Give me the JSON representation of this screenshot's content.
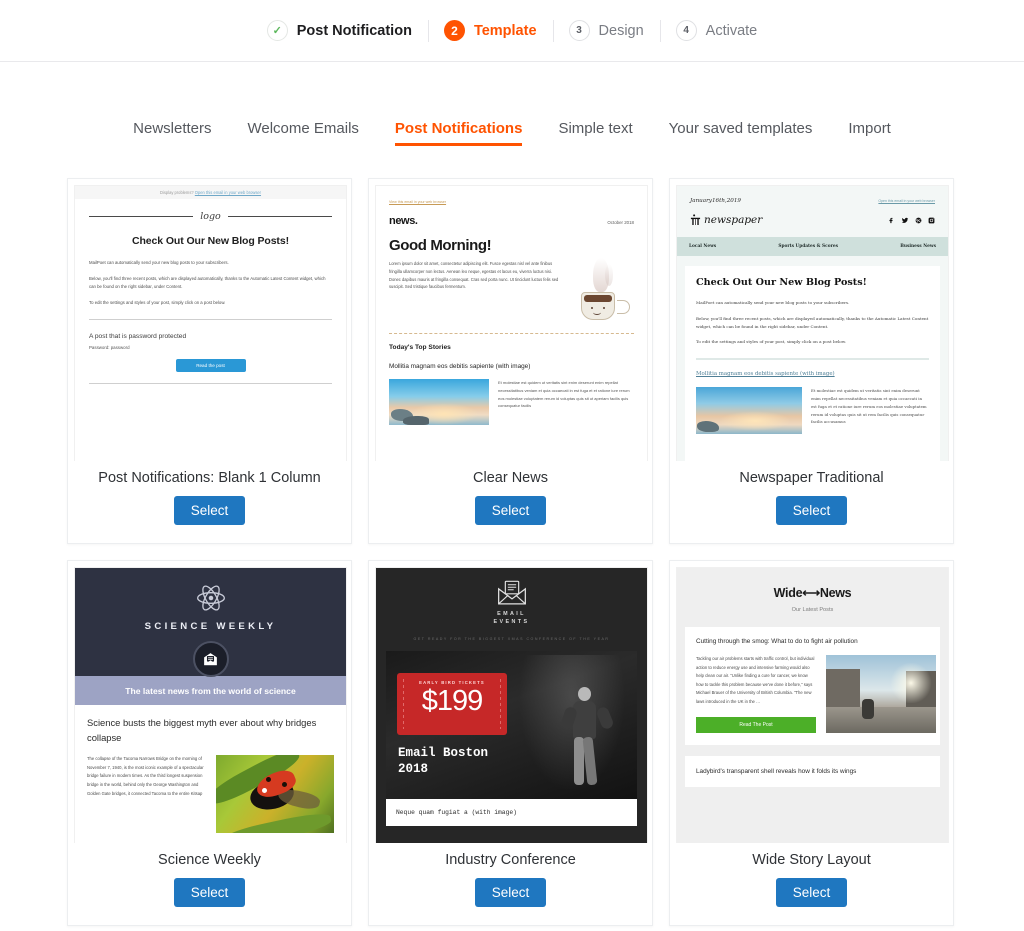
{
  "wizard": {
    "steps": [
      {
        "marker": "✓",
        "label": "Post Notification",
        "state": "done"
      },
      {
        "marker": "2",
        "label": "Template",
        "state": "active"
      },
      {
        "marker": "3",
        "label": "Design",
        "state": "todo"
      },
      {
        "marker": "4",
        "label": "Activate",
        "state": "todo"
      }
    ]
  },
  "tabs": [
    {
      "label": "Newsletters",
      "active": false
    },
    {
      "label": "Welcome Emails",
      "active": false
    },
    {
      "label": "Post Notifications",
      "active": true
    },
    {
      "label": "Simple text",
      "active": false
    },
    {
      "label": "Your saved templates",
      "active": false
    },
    {
      "label": "Import",
      "active": false
    }
  ],
  "colors": {
    "accent": "#ff5301",
    "select_button": "#1f77c0",
    "done_check": "#5cb85c",
    "science_header": "#2e3242",
    "science_banner": "#9da3c4",
    "newspaper_nav": "#cfe0dc",
    "ticket_red": "#c62828",
    "read_post_green": "#4caf28",
    "blog_button_blue": "#2a98d6"
  },
  "templates": [
    {
      "id": "blank-1-column",
      "title": "Post Notifications: Blank 1 Column",
      "select_label": "Select",
      "preview": {
        "display_problems": "Display problems?",
        "browser_link": "Open this email in your web browser",
        "logo": "logo",
        "heading": "Check Out Our New Blog Posts!",
        "paragraphs": [
          "MailPoet can automatically send your new blog posts to your subscribers.",
          "Below, you'll find three recent posts, which are displayed automatically, thanks to the Automatic Latest Content widget, which can be found on the right sidebar, under Content.",
          "To edit the settings and styles of your post, simply click on a post below."
        ],
        "post_title": "A post that is password protected",
        "password_line": "Password: password",
        "button": "Read the post"
      }
    },
    {
      "id": "clear-news",
      "title": "Clear News",
      "select_label": "Select",
      "preview": {
        "browser_link": "View this email in your web browser",
        "brand": "news.",
        "date": "October 2018",
        "heading": "Good Morning!",
        "lead": "Lorem ipsum dolor sit amet, consectetur adipiscing elit. Fusce egestas nisl vel ante finibus fringilla ullamcorper non lectus. Aenean leo neque, egestas et lacus eu, viverra luctus nisi. Donec dapibus mauris at fringilla consequat. Cras sed porta nunc. Ut tincidunt luctus felis sed suscipit. Sed tristique faucibus fermentum.",
        "section_title": "Today's Top Stories",
        "story_title": "Mollitia magnam eos debitis sapiente (with image)",
        "story_body": "Et molestiae est quidem ut veritatis sint enim deserunt enim repellat necessitatibus veniam et quia occaecati in est fuga et et ratione iure rerum eos molestiae voluptatem rerum id voluptas quis sit ut aperiam facilis quis consequatur facilis"
      }
    },
    {
      "id": "newspaper-traditional",
      "title": "Newspaper Traditional",
      "select_label": "Select",
      "preview": {
        "date": "January16th,2019",
        "browser_link": "Open this email in your web browser",
        "brand": "newspaper",
        "social": [
          "facebook-icon",
          "twitter-icon",
          "dribbble-icon",
          "instagram-icon"
        ],
        "nav": [
          "Local News",
          "Sports Updates & Scores",
          "Business News"
        ],
        "heading": "Check Out Our New Blog Posts!",
        "paragraphs": [
          "MailPoet can automatically send your new blog posts to your subscribers.",
          "Below, you'll find three recent posts, which are displayed automatically, thanks to the Automatic Latest Content widget, which can be found in the right sidebar, under Content.",
          "To edit the settings and styles of your post, simply click on a post below."
        ],
        "story_link": "Mollitia magnam eos debitis sapiente (with image)",
        "story_body": "Et molestiae est quidem ut veritatis sint enim deserunt enim repellat necessitatibus veniam et quia occaecati in est fuga et et ratione iure rerum eos molestiae voluptatem rerum id voluptas quis sit ut rem facilis quis consequatur facilis accusamus"
      }
    },
    {
      "id": "science-weekly",
      "title": "Science Weekly",
      "select_label": "Select",
      "preview": {
        "brand": "SCIENCE WEEKLY",
        "banner": "The latest news from the world of science",
        "headline": "Science busts the biggest myth ever about why bridges collapse",
        "body": "The collapse of the Tacoma Narrows Bridge on the morning of November 7, 1940, is the most iconic example of a spectacular bridge failure in modern times. As the third longest suspension bridge in the world, behind only the George Washington and Golden Gate bridges, it connected Tacoma to the entire Kitsap"
      }
    },
    {
      "id": "industry-conference",
      "title": "Industry Conference",
      "select_label": "Select",
      "preview": {
        "brand_line1": "EMAIL",
        "brand_line2": "EVENTS",
        "tagline": "GET READY FOR THE BIGGEST XMAS CONFERENCE OF THE YEAR",
        "ticket_label": "EARLY BIRD TICKETS",
        "price": "$199",
        "event_title": "Email Boston 2018",
        "caption": "Neque quam fugiat a (with image)"
      }
    },
    {
      "id": "wide-story-layout",
      "title": "Wide Story Layout",
      "select_label": "Select",
      "preview": {
        "brand_left": "Wide",
        "brand_arrow": "⟷",
        "brand_right": "News",
        "subtitle": "Our Latest Posts",
        "story1_title": "Cutting through the smog: What to do to fight air pollution",
        "story1_body": "Tackling our air problems starts with traffic control, but individual action to reduce energy use and intensive farming would also help clean our air. \"Unlike finding a cure for cancer, we know how to tackle this problem because we've done it before,\" says Michael Brauer of the University of British Columbia. \"The new laws introduced in the UK in the …",
        "button": "Read The Post",
        "story2_title": "Ladybird's transparent shell reveals how it folds its wings"
      }
    }
  ]
}
